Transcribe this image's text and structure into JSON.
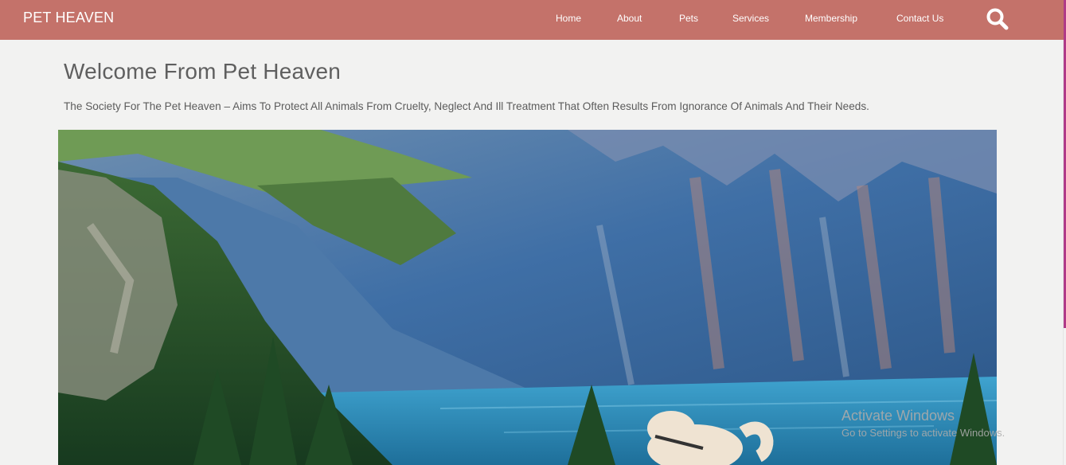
{
  "brand": {
    "name": "PET HEAVEN"
  },
  "nav": {
    "home": "Home",
    "about": "About",
    "pets": "Pets",
    "services": "Services",
    "membership": "Membership",
    "contact": "Contact Us",
    "search_icon": "search-icon"
  },
  "main": {
    "title": "Welcome From Pet Heaven",
    "intro": "The Society For The Pet Heaven – Aims To Protect All Animals From Cruelty, Neglect And Ill Treatment That Often Results From Ignorance Of Animals And Their Needs."
  },
  "watermark": {
    "title": "Activate Windows",
    "subtitle": "Go to Settings to activate Windows."
  },
  "colors": {
    "navbar": "#c4726a",
    "page_background": "#f2f2f1",
    "scroll_accent": "#b03a88",
    "text": "#5c5c5c"
  }
}
